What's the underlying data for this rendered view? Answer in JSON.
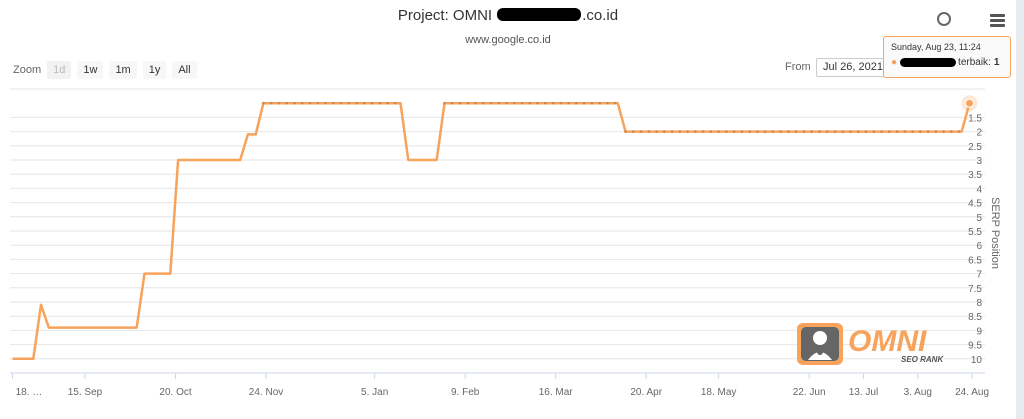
{
  "header": {
    "title_prefix": "Project: OMNI ",
    "title_suffix": ".co.id",
    "subtitle": "www.google.co.id"
  },
  "toolbar": {
    "zoom_label": "Zoom",
    "zoom_buttons": [
      "1d",
      "1w",
      "1m",
      "1y",
      "All"
    ],
    "from_label": "From",
    "from_value": "Jul 26, 2021"
  },
  "tooltip": {
    "date": "Sunday, Aug 23, 11:24",
    "series_suffix": "terbaik:",
    "value": "1"
  },
  "logo": {
    "brand": "OMNI",
    "tagline": "SEO RANK"
  },
  "colors": {
    "series": "#f7a35c",
    "grid": "#e6e6e6",
    "text": "#333333"
  },
  "chart_data": {
    "type": "line",
    "ylabel": "SERP Position",
    "y_reversed": true,
    "ylim": [
      1,
      10
    ],
    "y_ticks": [
      "1.5",
      "2",
      "2.5",
      "3",
      "3.5",
      "4",
      "4.5",
      "5",
      "5.5",
      "6",
      "6.5",
      "7",
      "7.5",
      "8",
      "8.5",
      "9",
      "9.5",
      "10"
    ],
    "y_tick_values": [
      1.5,
      2,
      2.5,
      3,
      3.5,
      4,
      4.5,
      5,
      5.5,
      6,
      6.5,
      7,
      7.5,
      8,
      8.5,
      9,
      9.5,
      10
    ],
    "x_ticks": [
      "18. …",
      "15. Sep",
      "20. Oct",
      "24. Nov",
      "5. Jan",
      "9. Feb",
      "16. Mar",
      "20. Apr",
      "18. May",
      "22. Jun",
      "13. Jul",
      "3. Aug",
      "24. Aug"
    ],
    "x_tick_days": [
      0,
      28,
      63,
      98,
      140,
      175,
      210,
      245,
      273,
      308,
      329,
      350,
      371
    ],
    "x_range_days": [
      -1,
      376
    ],
    "series": [
      {
        "points": [
          [
            0,
            10
          ],
          [
            8,
            10
          ],
          [
            11,
            8.1
          ],
          [
            14,
            8.9
          ],
          [
            48,
            8.9
          ],
          [
            51,
            7
          ],
          [
            61,
            7
          ],
          [
            64,
            3
          ],
          [
            88,
            3
          ],
          [
            91,
            2.1
          ],
          [
            94,
            2.1
          ],
          [
            97,
            1
          ],
          [
            150,
            1
          ],
          [
            153,
            3
          ],
          [
            164,
            3
          ],
          [
            167,
            1
          ],
          [
            234,
            1
          ],
          [
            237,
            2
          ],
          [
            367,
            2
          ],
          [
            370,
            1
          ]
        ],
        "markers": [
          [
            97,
            1
          ],
          [
            100,
            1
          ],
          [
            103,
            1
          ],
          [
            106,
            1
          ],
          [
            109,
            1
          ],
          [
            112,
            1
          ],
          [
            115,
            1
          ],
          [
            118,
            1
          ],
          [
            121,
            1
          ],
          [
            124,
            1
          ],
          [
            127,
            1
          ],
          [
            130,
            1
          ],
          [
            133,
            1
          ],
          [
            136,
            1
          ],
          [
            139,
            1
          ],
          [
            142,
            1
          ],
          [
            145,
            1
          ],
          [
            148,
            1
          ],
          [
            167,
            1
          ],
          [
            170,
            1
          ],
          [
            173,
            1
          ],
          [
            176,
            1
          ],
          [
            179,
            1
          ],
          [
            182,
            1
          ],
          [
            185,
            1
          ],
          [
            188,
            1
          ],
          [
            191,
            1
          ],
          [
            194,
            1
          ],
          [
            197,
            1
          ],
          [
            200,
            1
          ],
          [
            203,
            1
          ],
          [
            206,
            1
          ],
          [
            209,
            1
          ],
          [
            212,
            1
          ],
          [
            215,
            1
          ],
          [
            218,
            1
          ],
          [
            221,
            1
          ],
          [
            224,
            1
          ],
          [
            227,
            1
          ],
          [
            230,
            1
          ],
          [
            233,
            1
          ],
          [
            237,
            2
          ],
          [
            240,
            2
          ],
          [
            243,
            2
          ],
          [
            246,
            2
          ],
          [
            249,
            2
          ],
          [
            252,
            2
          ],
          [
            255,
            2
          ],
          [
            258,
            2
          ],
          [
            261,
            2
          ],
          [
            264,
            2
          ],
          [
            267,
            2
          ],
          [
            270,
            2
          ],
          [
            273,
            2
          ],
          [
            276,
            2
          ],
          [
            279,
            2
          ],
          [
            282,
            2
          ],
          [
            285,
            2
          ],
          [
            288,
            2
          ],
          [
            291,
            2
          ],
          [
            294,
            2
          ],
          [
            297,
            2
          ],
          [
            300,
            2
          ],
          [
            303,
            2
          ],
          [
            306,
            2
          ],
          [
            309,
            2
          ],
          [
            312,
            2
          ],
          [
            315,
            2
          ],
          [
            318,
            2
          ],
          [
            321,
            2
          ],
          [
            324,
            2
          ],
          [
            327,
            2
          ],
          [
            330,
            2
          ],
          [
            333,
            2
          ],
          [
            336,
            2
          ],
          [
            339,
            2
          ],
          [
            342,
            2
          ],
          [
            345,
            2
          ],
          [
            348,
            2
          ],
          [
            351,
            2
          ],
          [
            354,
            2
          ],
          [
            357,
            2
          ],
          [
            360,
            2
          ],
          [
            363,
            2
          ],
          [
            366,
            2
          ]
        ],
        "highlight": [
          370,
          1
        ]
      }
    ]
  }
}
